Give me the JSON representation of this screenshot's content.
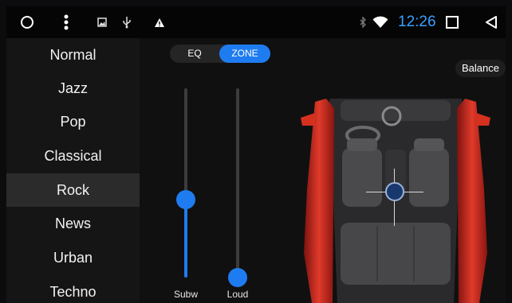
{
  "status_bar": {
    "left_icons": [
      "home-circle-icon",
      "more-vert-icon",
      "gallery-icon",
      "usb-icon",
      "warning-icon"
    ],
    "right_icons": [
      "bluetooth-icon",
      "wifi-icon"
    ],
    "time": "12:26",
    "nav_icons": [
      "recents-square-icon",
      "back-triangle-icon"
    ],
    "accent_color": "#3aa0ff"
  },
  "presets": {
    "items": [
      "Normal",
      "Jazz",
      "Pop",
      "Classical",
      "Rock",
      "News",
      "Urban",
      "Techno"
    ],
    "selected": "Rock"
  },
  "tabs": {
    "eq_label": "EQ",
    "zone_label": "ZONE",
    "active": "ZONE"
  },
  "sliders": {
    "subw": {
      "label": "Subw",
      "level": 0.41
    },
    "loud": {
      "label": "Loud",
      "level": 0.0
    }
  },
  "balance": {
    "button_label": "Balance"
  },
  "colors": {
    "accent": "#1f7cf0",
    "car_body": "#c8261f",
    "background": "#0c0c0e"
  }
}
